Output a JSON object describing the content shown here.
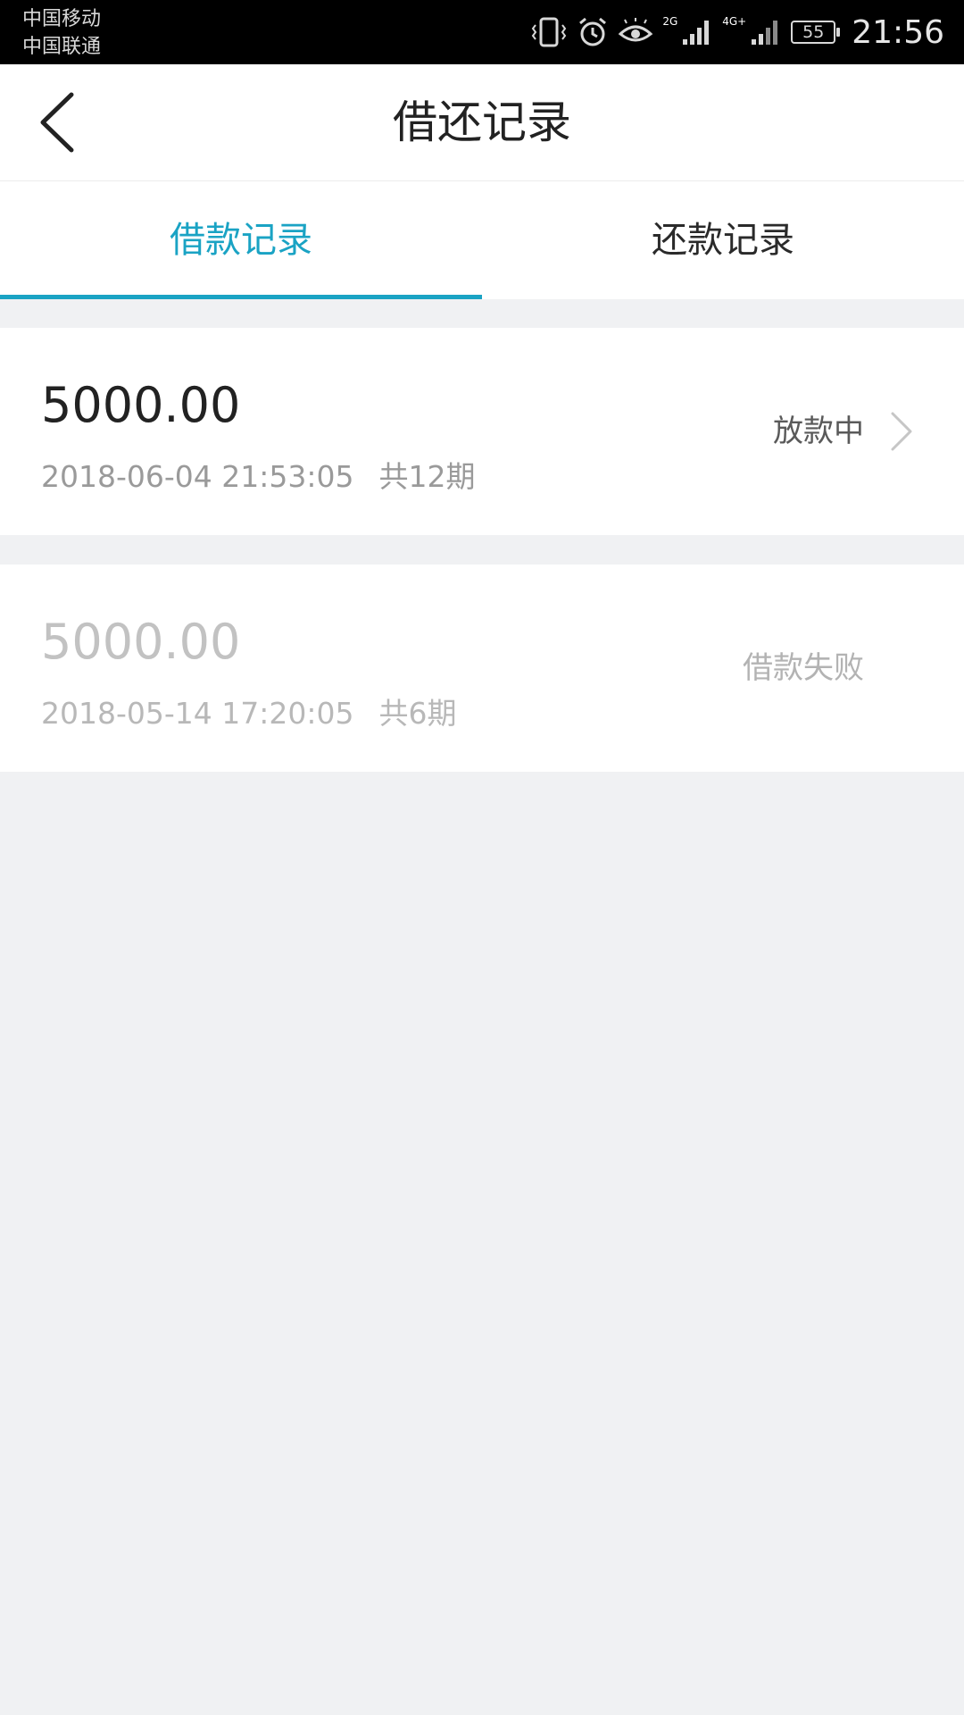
{
  "status_bar": {
    "carrier_1": "中国移动",
    "carrier_2": "中国联通",
    "network_1": "2G",
    "network_2": "4G+",
    "battery": "55",
    "time": "21:56"
  },
  "header": {
    "title": "借还记录"
  },
  "tabs": [
    {
      "label": "借款记录",
      "active": true
    },
    {
      "label": "还款记录",
      "active": false
    }
  ],
  "records": [
    {
      "amount": "5000.00",
      "datetime": "2018-06-04 21:53:05",
      "periods": "共12期",
      "status": "放款中"
    },
    {
      "amount": "5000.00",
      "datetime": "2018-05-14 17:20:05",
      "periods": "共6期",
      "status": "借款失败"
    }
  ],
  "colors": {
    "accent": "#1aa3c4",
    "background": "#f0f1f3",
    "status_bar": "#000000"
  },
  "icons": {
    "back": "chevron-left-icon",
    "record_arrow": "chevron-right-icon"
  }
}
